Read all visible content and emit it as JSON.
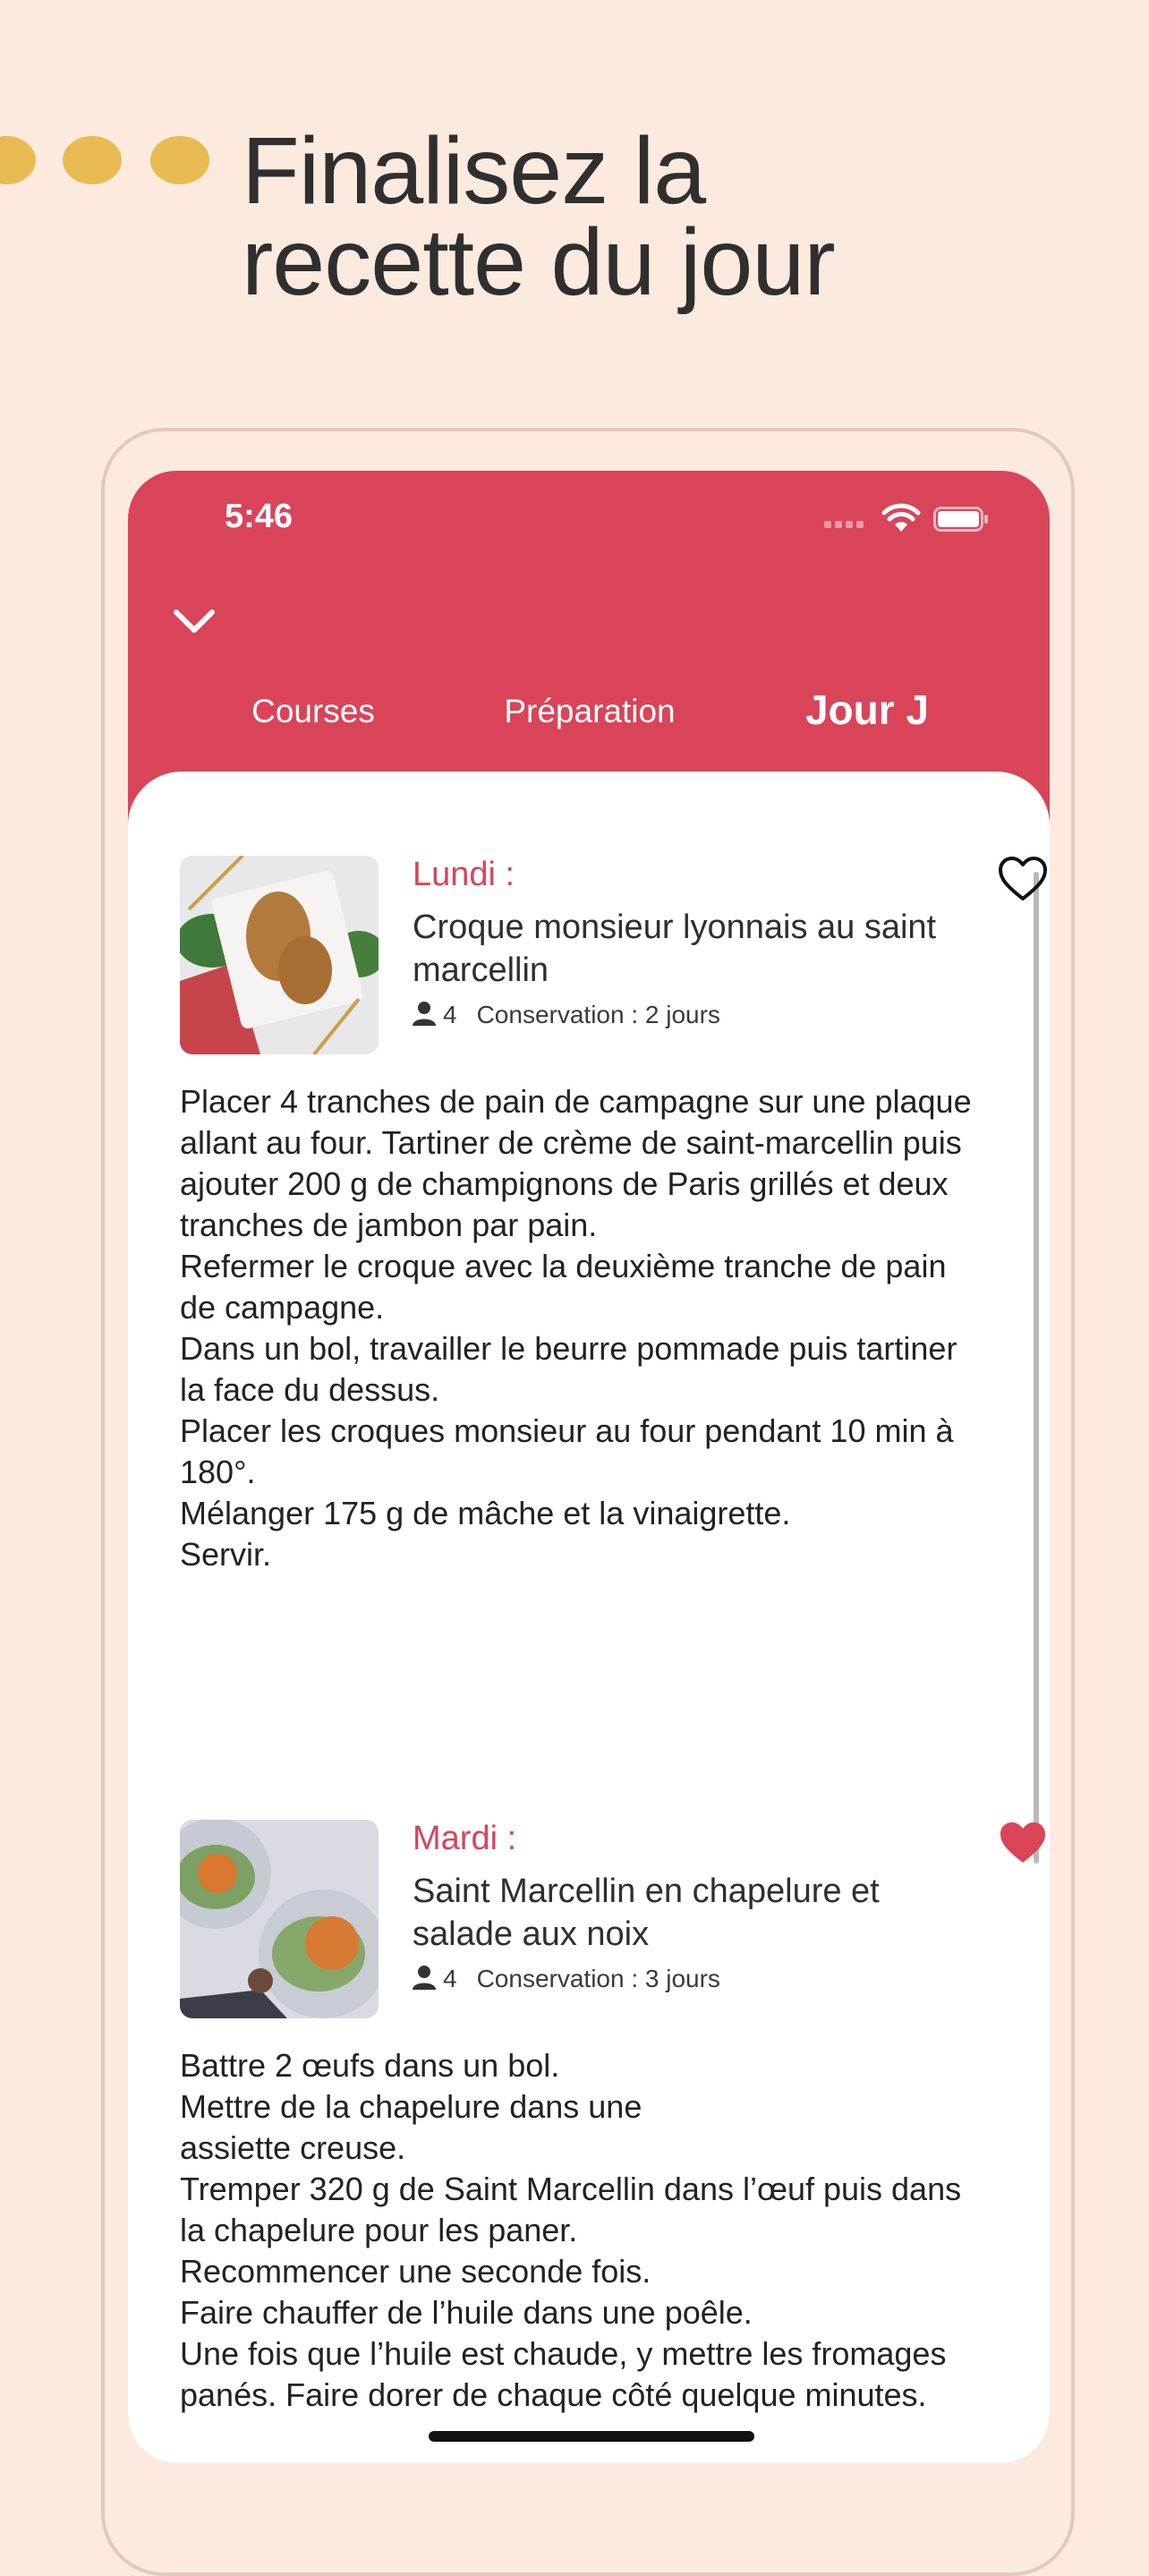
{
  "headline": {
    "line1": "Finalisez la",
    "line2": "recette du jour"
  },
  "colors": {
    "brand": "#d94459",
    "background": "#fdeadf",
    "dots": "#e8bb52"
  },
  "status_bar": {
    "time": "5:46",
    "icons": [
      "cellular-icon",
      "wifi-icon",
      "battery-icon"
    ]
  },
  "nav": {
    "back_icon": "chevron-down-icon",
    "tabs": [
      {
        "label": "Courses",
        "selected": false
      },
      {
        "label": "Préparation",
        "selected": false
      },
      {
        "label": "Jour J",
        "selected": true
      }
    ]
  },
  "recipes": [
    {
      "day": "Lundi :",
      "title": "Croque monsieur lyonnais au saint marcellin",
      "servings": "4",
      "conservation": "Conservation : 2 jours",
      "favorite": false,
      "instructions": [
        "Placer 4 tranches de pain de campagne sur une plaque allant au four. Tartiner de crème de saint-marcellin puis ajouter 200 g de champignons de Paris grillés et deux tranches de jambon par pain.",
        "Refermer le croque avec la deuxième tranche de pain de campagne.",
        "Dans un bol, travailler le beurre pommade puis tartiner la face du dessus.",
        "Placer les croques monsieur au four pendant 10 min à 180°.",
        "Mélanger 175 g de mâche et la vinaigrette.",
        "Servir."
      ]
    },
    {
      "day": "Mardi :",
      "title": "Saint Marcellin en chapelure et salade aux noix",
      "servings": "4",
      "conservation": "Conservation : 3 jours",
      "favorite": true,
      "instructions": [
        "Battre 2 œufs dans un bol.",
        "Mettre de la chapelure dans une\nassiette creuse.",
        "Tremper 320 g de Saint Marcellin dans l’œuf puis dans la chapelure pour les paner.",
        "Recommencer une seconde fois.",
        "Faire chauffer de l’huile dans une poêle.",
        "Une fois que l’huile est chaude, y mettre les fromages panés. Faire dorer de chaque côté quelque minutes."
      ]
    }
  ]
}
